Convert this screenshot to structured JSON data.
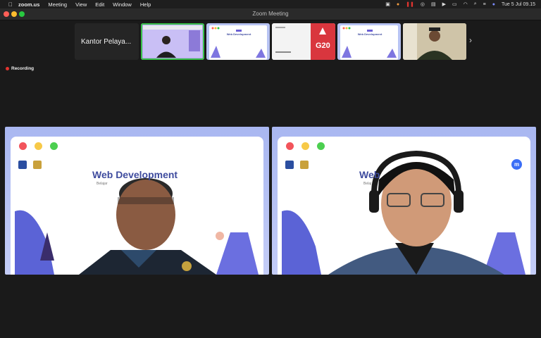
{
  "menubar": {
    "app_name": "zoom.us",
    "menus": [
      "Meeting",
      "View",
      "Edit",
      "Window",
      "Help"
    ],
    "datetime": "Tue 5 Jul  09.15"
  },
  "window": {
    "title": "Zoom Meeting"
  },
  "strip": {
    "first_tile_name": "Kantor Pelaya...",
    "thumb_slide_title": "Web Development",
    "g20_label": "G20"
  },
  "recording": {
    "label": "Recording"
  },
  "videos": [
    {
      "slide_title": "Web Development",
      "slide_subtitle": "Belajar"
    },
    {
      "slide_title": "Web",
      "slide_subtitle": "Belaj"
    }
  ],
  "colors": {
    "accent": "#39c24a",
    "recording": "#e3342f",
    "slide_bg": "#a9b7f1",
    "slide_title": "#3e4b9e"
  }
}
